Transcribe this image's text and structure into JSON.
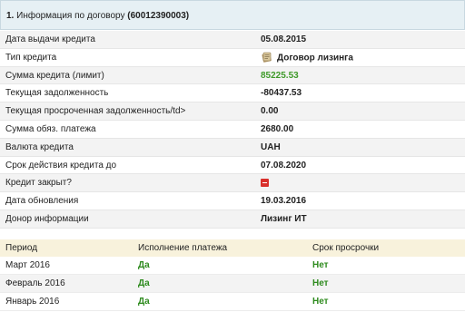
{
  "header": {
    "number": "1.",
    "title": "Информация по договору",
    "contract_id": "(60012390003)"
  },
  "details": [
    {
      "label": "Дата выдачи кредита",
      "value": "05.08.2015"
    },
    {
      "label": "Тип кредита",
      "value": "Договор лизинга",
      "icon": "lease-document-icon"
    },
    {
      "label": "Сумма кредита (лимит)",
      "value": "85225.53",
      "color": "#3f9a2a"
    },
    {
      "label": "Текущая задолженность",
      "value": "-80437.53"
    },
    {
      "label": "Текущая просроченная задолженность/td>",
      "value": "0.00"
    },
    {
      "label": "Сумма обяз. платежа",
      "value": "2680.00"
    },
    {
      "label": "Валюта кредита",
      "value": "UAH"
    },
    {
      "label": "Срок действия кредита до",
      "value": "07.08.2020"
    },
    {
      "label": "Кредит закрыт?",
      "value": "",
      "icon": "not-closed-icon"
    },
    {
      "label": "Дата обновления",
      "value": "19.03.2016"
    },
    {
      "label": "Донор информации",
      "value": "Лизинг ИТ"
    }
  ],
  "history": {
    "headers": [
      "Период",
      "Исполнение платежа",
      "Срок просрочки"
    ],
    "rows": [
      [
        "Март 2016",
        "Да",
        "Нет"
      ],
      [
        "Февраль 2016",
        "Да",
        "Нет"
      ],
      [
        "Январь 2016",
        "Да",
        "Нет"
      ]
    ]
  }
}
